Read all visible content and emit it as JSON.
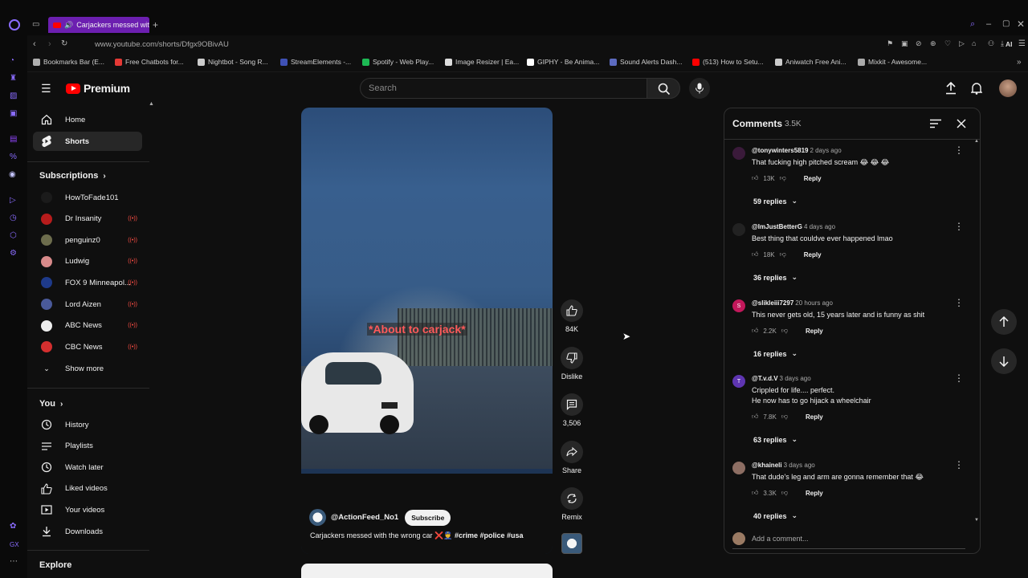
{
  "browser": {
    "tab_title": "Carjackers messed wit",
    "url": "www.youtube.com/shorts/Dfgx9OBivAU",
    "ai_label": "AI",
    "bookmarks": [
      {
        "label": "Bookmarks Bar (E...",
        "color": "#b0b0b0"
      },
      {
        "label": "Free Chatbots for...",
        "color": "#e53935"
      },
      {
        "label": "Nightbot - Song R...",
        "color": "#cccccc"
      },
      {
        "label": "StreamElements -...",
        "color": "#3f51b5"
      },
      {
        "label": "Spotify - Web Play...",
        "color": "#1db954"
      },
      {
        "label": "Image Resizer | Ea...",
        "color": "#dddddd"
      },
      {
        "label": "GIPHY - Be Anima...",
        "color": "#ffffff"
      },
      {
        "label": "Sound Alerts Dash...",
        "color": "#5c6bc0"
      },
      {
        "label": "(513) How to Setu...",
        "color": "#ff0000"
      },
      {
        "label": "Aniwatch Free Ani...",
        "color": "#cccccc"
      },
      {
        "label": "Mixkit - Awesome...",
        "color": "#aaaaaa"
      }
    ]
  },
  "masthead": {
    "brand": "Premium",
    "search_placeholder": "Search"
  },
  "sidebar": {
    "top": [
      {
        "label": "Home",
        "icon": "home-icon"
      },
      {
        "label": "Shorts",
        "icon": "shorts-icon",
        "active": true
      }
    ],
    "subscriptions_title": "Subscriptions",
    "subscriptions": [
      {
        "label": "HowToFade101",
        "live": false,
        "color": "#1b1b1b"
      },
      {
        "label": "Dr Insanity",
        "live": true,
        "color": "#b71c1c"
      },
      {
        "label": "penguinz0",
        "live": true,
        "color": "#6d6d4d"
      },
      {
        "label": "Ludwig",
        "live": true,
        "color": "#d88a8a"
      },
      {
        "label": "FOX 9 Minneapol...",
        "live": true,
        "color": "#1e3a8a"
      },
      {
        "label": "Lord Aizen",
        "live": true,
        "color": "#4a5a9a"
      },
      {
        "label": "ABC News",
        "live": true,
        "color": "#eeeeee"
      },
      {
        "label": "CBC News",
        "live": true,
        "color": "#d32f2f"
      }
    ],
    "show_more": "Show more",
    "you_title": "You",
    "you_items": [
      {
        "label": "History",
        "icon": "history-icon"
      },
      {
        "label": "Playlists",
        "icon": "playlists-icon"
      },
      {
        "label": "Watch later",
        "icon": "watch-later-icon"
      },
      {
        "label": "Liked videos",
        "icon": "like-icon"
      },
      {
        "label": "Your videos",
        "icon": "your-videos-icon"
      },
      {
        "label": "Downloads",
        "icon": "download-icon"
      }
    ],
    "explore_title": "Explore"
  },
  "short": {
    "caption": "*About to carjack*",
    "channel": "@ActionFeed_No1",
    "subscribe": "Subscribe",
    "title_plain": "Carjackers messed with the wrong car ❌👮",
    "title_tags": "#crime #police #usa",
    "likes": "84K",
    "dislike": "Dislike",
    "comments": "3,506",
    "share": "Share",
    "remix": "Remix"
  },
  "comments_panel": {
    "title": "Comments",
    "count": "3.5K",
    "add_placeholder": "Add a comment...",
    "reply_label": "Reply",
    "items": [
      {
        "user": "@tonywinters5819",
        "time": "2 days ago",
        "text": [
          "That fucking high pitched scream 😂 😂 😂"
        ],
        "likes": "13K",
        "replies": "59 replies",
        "avatar": "#3a1a3a"
      },
      {
        "user": "@ImJustBetterG",
        "time": "4 days ago",
        "text": [
          "Best thing that couldve ever happened lmao"
        ],
        "likes": "18K",
        "replies": "36 replies",
        "avatar": "#222222"
      },
      {
        "user": "@slikleiii7297",
        "time": "20 hours ago",
        "text": [
          "This never gets old, 15 years later and is funny as shit"
        ],
        "likes": "2.2K",
        "replies": "16 replies",
        "avatar": "#c2185b",
        "initial": "S"
      },
      {
        "user": "@T.v.d.V",
        "time": "3 days ago",
        "text": [
          "Crippled for life.... perfect.",
          "He now has to go hijack a wheelchair"
        ],
        "likes": "7.8K",
        "replies": "63 replies",
        "avatar": "#5e35b1",
        "initial": "T"
      },
      {
        "user": "@khaineli",
        "time": "3 days ago",
        "text": [
          "That dude's leg and arm are gonna remember that 😂"
        ],
        "likes": "3.3K",
        "replies": "40 replies",
        "avatar": "#8d6e63"
      }
    ]
  }
}
